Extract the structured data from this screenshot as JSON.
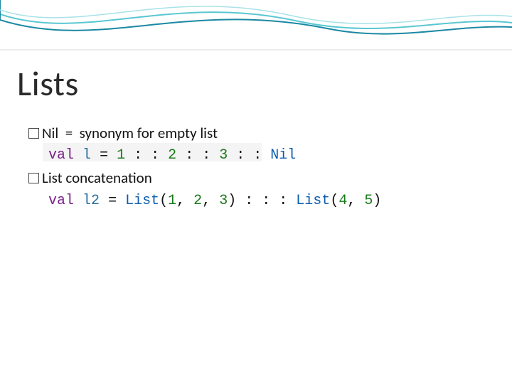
{
  "title": "Lists",
  "bullets": {
    "b1": {
      "marker": "□",
      "text": "Nil  =  synonym for empty list"
    },
    "b2": {
      "marker": "□",
      "text": "List concatenation"
    }
  },
  "code": {
    "line1": {
      "kw_val": "val",
      "id": "l",
      "eq": "=",
      "n1": "1",
      "cons1": ": :",
      "n2": "2",
      "cons2": ": :",
      "n3": "3",
      "cons3": ": :",
      "nil": "Nil"
    },
    "line2": {
      "kw_val": "val",
      "id": "l2",
      "eq": "=",
      "list1": "List",
      "lp1": "(",
      "a1": "1",
      "c1": ",",
      "a2": "2",
      "c2": ",",
      "a3": "3",
      "rp1": ")",
      "concat": ": : :",
      "list2": "List",
      "lp2": "(",
      "b1": "4",
      "c3": ",",
      "b2": "5",
      "rp2": ")"
    }
  }
}
